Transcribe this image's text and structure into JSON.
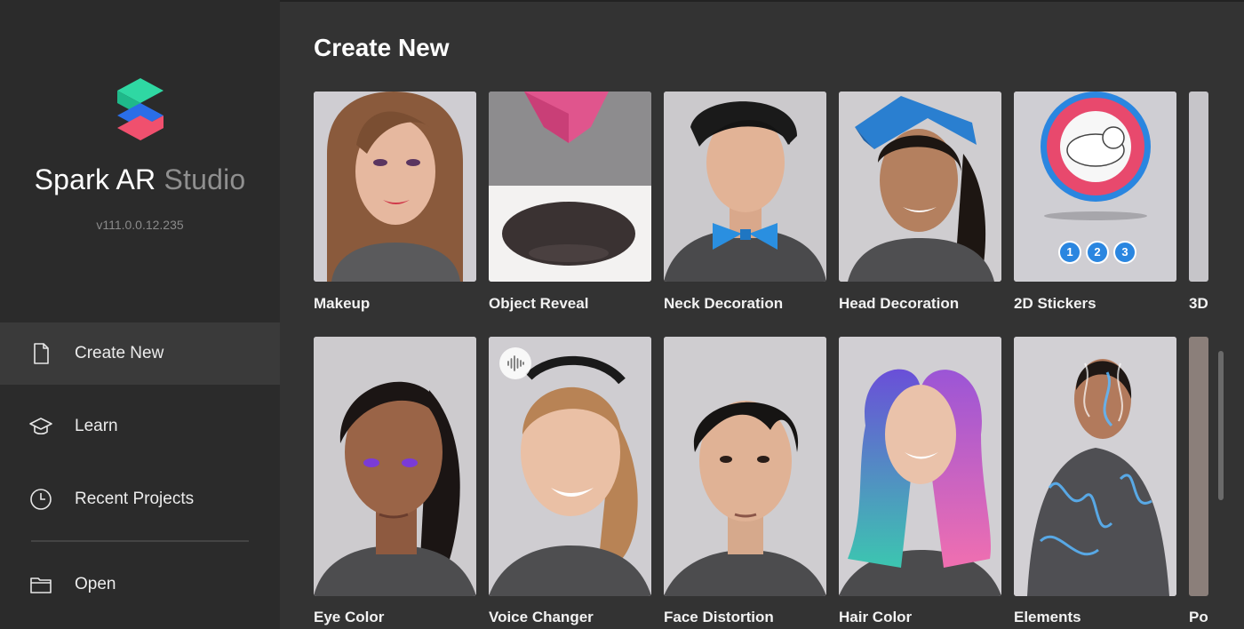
{
  "app": {
    "name_primary": "Spark AR",
    "name_secondary": "Studio",
    "version": "v111.0.0.12.235",
    "logo_colors": [
      "#2fd8a3",
      "#2a6ee8",
      "#f0506e"
    ]
  },
  "sidebar": {
    "items": [
      {
        "label": "Create New",
        "icon": "document-icon",
        "active": true
      },
      {
        "label": "Learn",
        "icon": "graduation-cap-icon",
        "active": false
      },
      {
        "label": "Recent Projects",
        "icon": "clock-icon",
        "active": false
      },
      {
        "label": "Open",
        "icon": "folder-icon",
        "active": false
      }
    ]
  },
  "main": {
    "title": "Create New",
    "row1": [
      {
        "label": "Makeup"
      },
      {
        "label": "Object Reveal"
      },
      {
        "label": "Neck Decoration"
      },
      {
        "label": "Head Decoration"
      },
      {
        "label": "2D Stickers"
      },
      {
        "label": "3D"
      }
    ],
    "row2": [
      {
        "label": "Eye Color",
        "badge": null
      },
      {
        "label": "Voice Changer",
        "badge": "audio-waveform-icon"
      },
      {
        "label": "Face Distortion",
        "badge": null
      },
      {
        "label": "Hair Color",
        "badge": null
      },
      {
        "label": "Elements",
        "badge": null
      },
      {
        "label": "Po"
      }
    ],
    "sticker_numbers": [
      "1",
      "2",
      "3"
    ]
  },
  "colors": {
    "sidebar_bg": "#2b2b2b",
    "main_bg": "#333333",
    "active_item_bg": "#3a3a3a"
  }
}
